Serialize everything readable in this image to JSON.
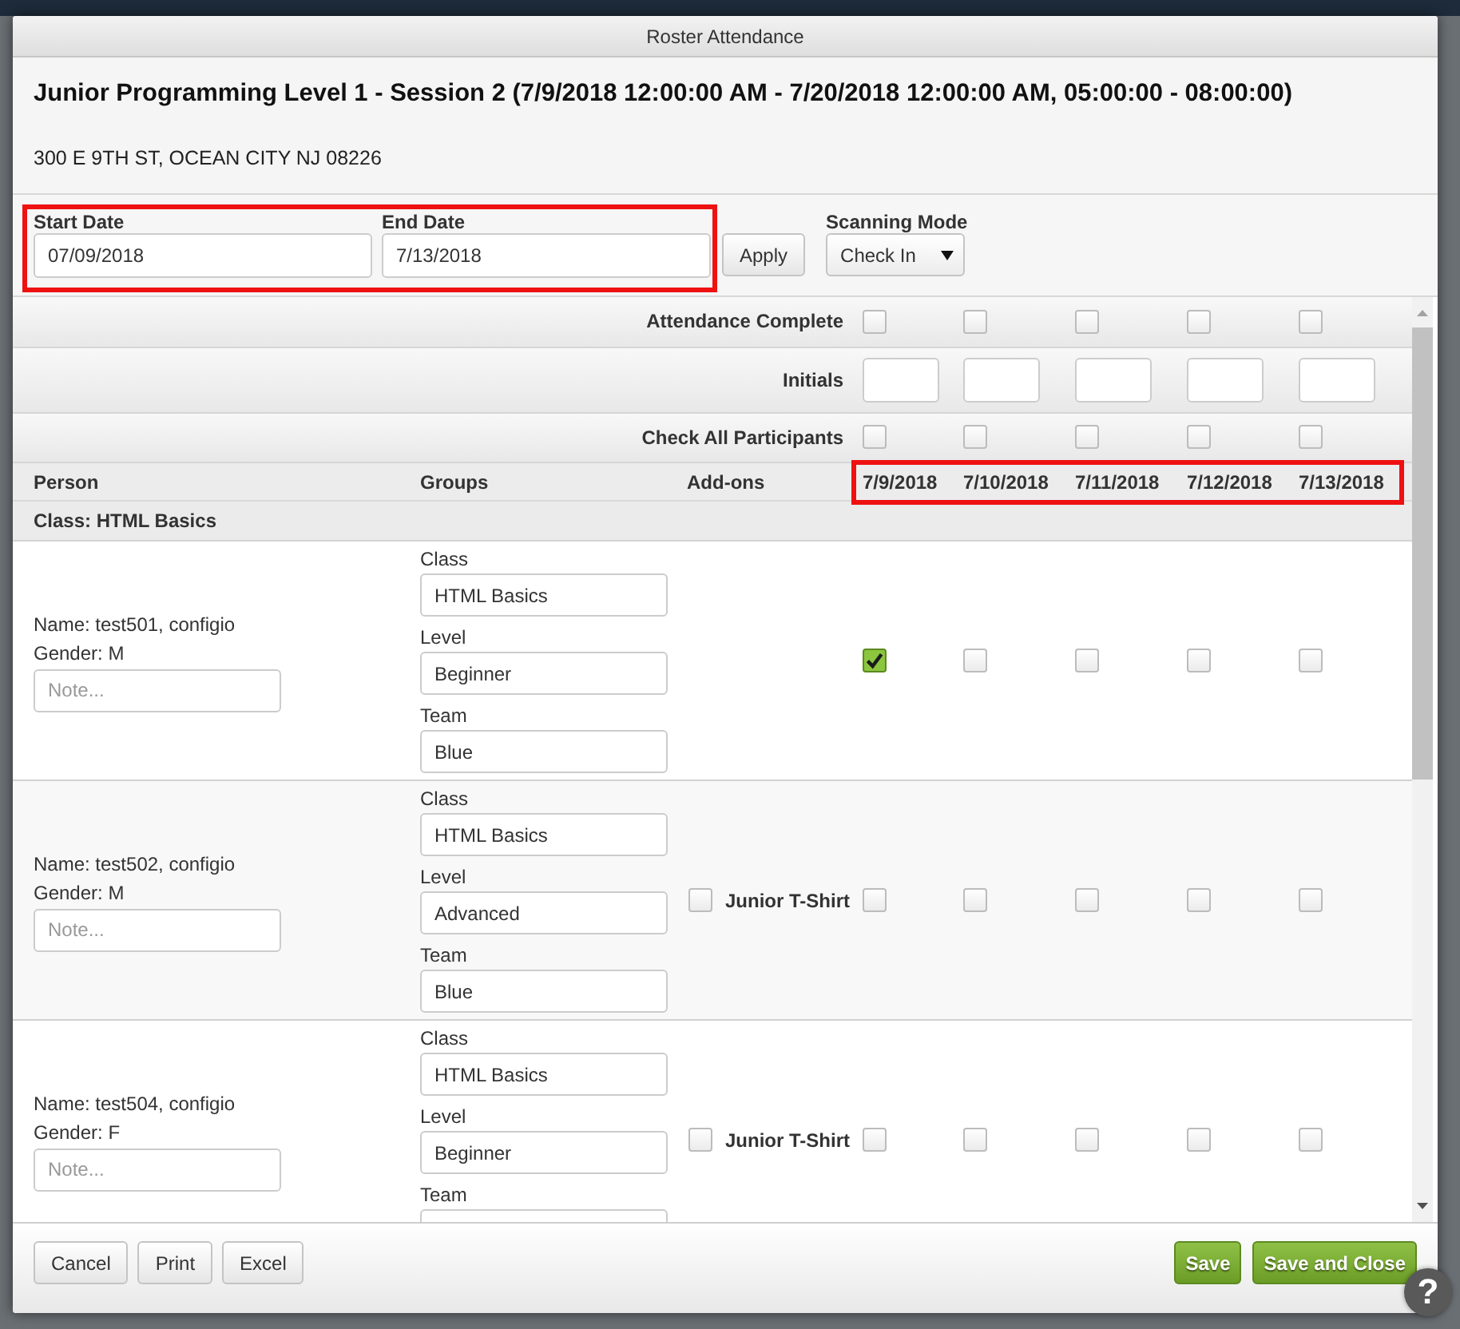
{
  "dialog": {
    "title": "Roster Attendance"
  },
  "header": {
    "title": "Junior Programming Level 1 - Session 2 (7/9/2018 12:00:00 AM - 7/20/2018 12:00:00 AM, 05:00:00 - 08:00:00)",
    "address": "300 E 9TH ST, OCEAN CITY NJ 08226"
  },
  "filters": {
    "date_range": {
      "highlighted": true,
      "start_date": {
        "label": "Start Date",
        "value": "07/09/2018"
      },
      "end_date": {
        "label": "End Date",
        "value": "7/13/2018"
      }
    },
    "apply_button": "Apply",
    "scanning_mode": {
      "label": "Scanning Mode",
      "value": "Check In"
    }
  },
  "summary_rows": [
    {
      "kind": "checkbox",
      "label": "Attendance Complete",
      "checked": [
        false,
        false,
        false,
        false,
        false
      ]
    },
    {
      "kind": "input",
      "label": "Initials"
    },
    {
      "kind": "checkbox",
      "label": "Check All Participants",
      "checked": [
        false,
        false,
        false,
        false,
        false
      ]
    }
  ],
  "table": {
    "columns": [
      "Person",
      "Groups",
      "Add-ons"
    ],
    "date_columns": {
      "highlighted": true,
      "dates": [
        "7/9/2018",
        "7/10/2018",
        "7/11/2018",
        "7/12/2018",
        "7/13/2018"
      ]
    },
    "group_heading": "Class: HTML Basics",
    "rows": [
      {
        "name": "Name: test501, configio",
        "gender": "Gender: M",
        "note": {
          "placeholder": "Note..."
        },
        "groups": [
          {
            "label": "Class",
            "value": "HTML Basics"
          },
          {
            "label": "Level",
            "value": "Beginner"
          },
          {
            "label": "Team",
            "value": "Blue"
          }
        ],
        "attendance": [
          true,
          false,
          false,
          false,
          false
        ]
      },
      {
        "name": "Name: test502, configio",
        "gender": "Gender: M",
        "note": {
          "placeholder": "Note..."
        },
        "groups": [
          {
            "label": "Class",
            "value": "HTML Basics"
          },
          {
            "label": "Level",
            "value": "Advanced"
          },
          {
            "label": "Team",
            "value": "Blue"
          }
        ],
        "addons": [
          {
            "label": "Junior T-Shirt",
            "checked": false
          }
        ],
        "attendance": [
          false,
          false,
          false,
          false,
          false
        ]
      },
      {
        "name": "Name: test504, configio",
        "gender": "Gender: F",
        "note": {
          "placeholder": "Note..."
        },
        "groups": [
          {
            "label": "Class",
            "value": "HTML Basics"
          },
          {
            "label": "Level",
            "value": "Beginner"
          },
          {
            "label": "Team"
          }
        ],
        "addons": [
          {
            "label": "Junior T-Shirt",
            "checked": false
          }
        ],
        "attendance": [
          false,
          false,
          false,
          false,
          false
        ]
      }
    ]
  },
  "footer": {
    "left_buttons": [
      {
        "label": "Cancel",
        "kind": "default"
      },
      {
        "label": "Print",
        "kind": "default"
      },
      {
        "label": "Excel",
        "kind": "default"
      }
    ],
    "right_buttons": [
      {
        "label": "Save",
        "kind": "primary"
      },
      {
        "label": "Save and Close",
        "kind": "primary"
      }
    ]
  },
  "help_button": "?"
}
